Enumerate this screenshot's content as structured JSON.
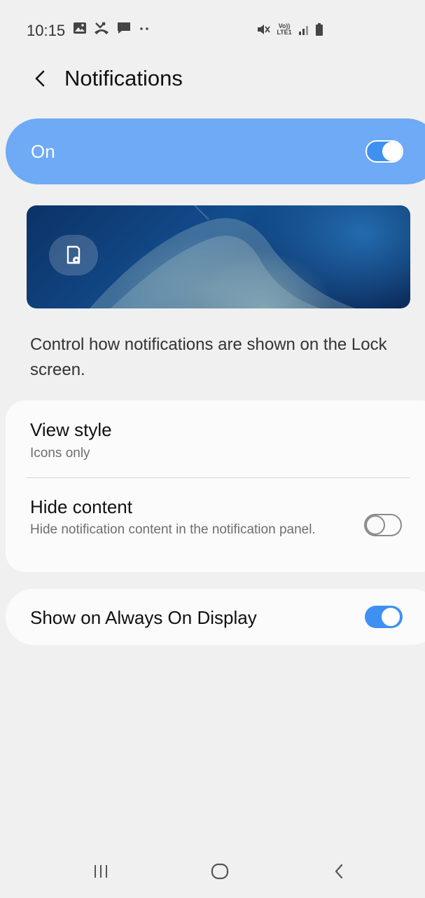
{
  "status_bar": {
    "time": "10:15",
    "left_icons": [
      "image-icon",
      "missed-call-icon",
      "message-icon",
      "more-dots-icon"
    ],
    "right_icons": [
      "mute-icon",
      "volte-lte-icon",
      "signal-icon",
      "battery-icon"
    ],
    "volte_text": "Vo)) LTE1"
  },
  "header": {
    "title": "Notifications",
    "back_icon": "chevron-left-icon"
  },
  "master_switch": {
    "label": "On",
    "checked": true,
    "background_color": "#6eaaf5"
  },
  "preview": {
    "settings_icon": "lockscreen-settings-icon"
  },
  "description": "Control how notifications are shown on the Lock screen.",
  "settings": {
    "view_style": {
      "title": "View style",
      "value": "Icons only"
    },
    "hide_content": {
      "title": "Hide content",
      "subtitle": "Hide notification content in the notification panel.",
      "checked": false
    },
    "always_on_display": {
      "title": "Show on Always On Display",
      "checked": true
    }
  },
  "nav_bar": {
    "recents_icon": "recents-icon",
    "home_icon": "home-icon",
    "back_icon": "back-icon"
  },
  "colors": {
    "accent": "#3e91f0",
    "background": "#f0f0f0",
    "card": "#fbfbfb"
  }
}
